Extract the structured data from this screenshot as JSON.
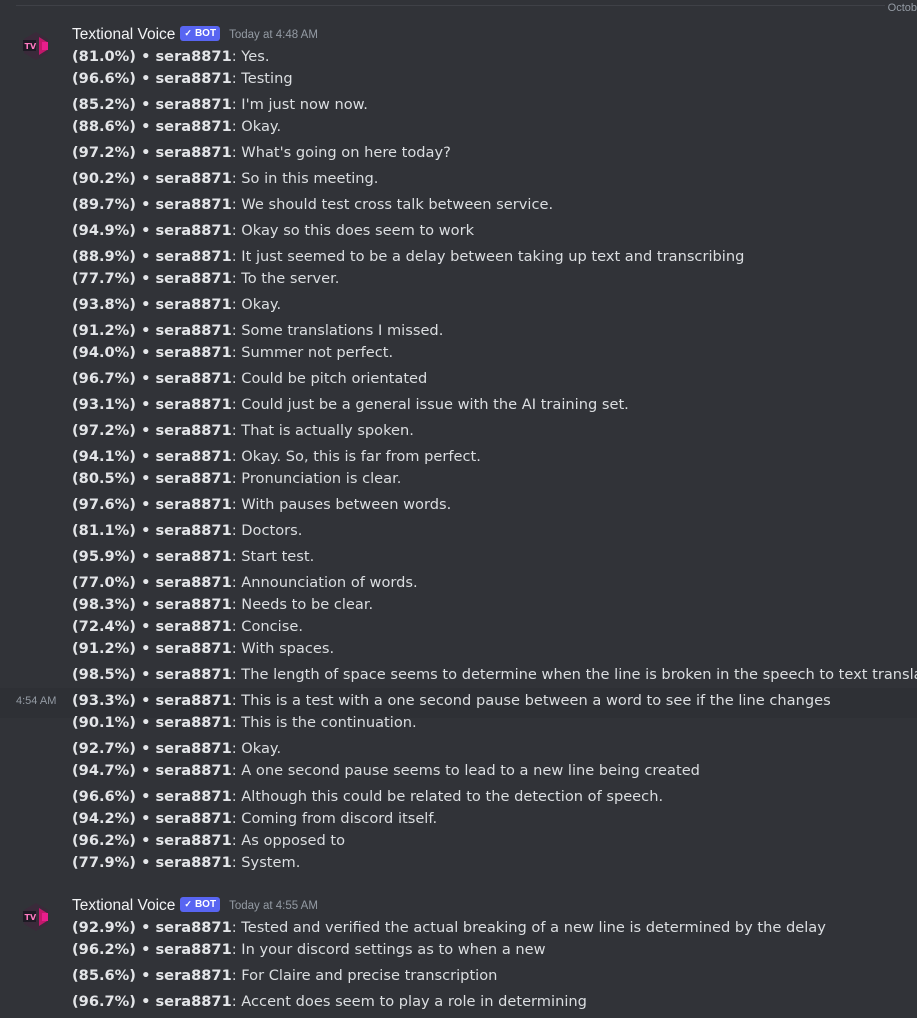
{
  "date_divider": "Octob",
  "groups": [
    {
      "author": "Textional Voice",
      "bot_label": "BOT",
      "timestamp": "Today at 4:48 AM",
      "avatar_text": "TV",
      "lines": [
        {
          "pct": "(81.0%)",
          "sep": " • ",
          "user": "sera8871",
          "text": ": Yes."
        },
        {
          "pct": "(96.6%)",
          "sep": " • ",
          "user": "sera8871",
          "text": ": Testing"
        },
        {
          "pct": "(85.2%)",
          "sep": " • ",
          "user": "sera8871",
          "text": ": I'm just now now."
        },
        {
          "pct": "(88.6%)",
          "sep": " • ",
          "user": "sera8871",
          "text": ": Okay."
        },
        {
          "pct": "(97.2%)",
          "sep": " • ",
          "user": "sera8871",
          "text": ": What's going on here today?"
        },
        {
          "pct": "(90.2%)",
          "sep": " • ",
          "user": "sera8871",
          "text": ": So in this meeting."
        },
        {
          "pct": "(89.7%)",
          "sep": " • ",
          "user": "sera8871",
          "text": ": We should test cross talk between service."
        },
        {
          "pct": "(94.9%)",
          "sep": " • ",
          "user": "sera8871",
          "text": ": Okay so this does seem to work"
        },
        {
          "pct": "(88.9%)",
          "sep": " • ",
          "user": "sera8871",
          "text": ": It just seemed to be a delay between taking up text and transcribing"
        },
        {
          "pct": "(77.7%)",
          "sep": " • ",
          "user": "sera8871",
          "text": ": To the server."
        },
        {
          "pct": "(93.8%)",
          "sep": " • ",
          "user": "sera8871",
          "text": ": Okay."
        },
        {
          "pct": "(91.2%)",
          "sep": " • ",
          "user": "sera8871",
          "text": ": Some translations I missed."
        },
        {
          "pct": "(94.0%)",
          "sep": " • ",
          "user": "sera8871",
          "text": ": Summer not perfect."
        },
        {
          "pct": "(96.7%)",
          "sep": " • ",
          "user": "sera8871",
          "text": ": Could be pitch orientated"
        },
        {
          "pct": "(93.1%)",
          "sep": " • ",
          "user": "sera8871",
          "text": ": Could just be a general issue with the AI training set."
        },
        {
          "pct": "(97.2%)",
          "sep": " • ",
          "user": "sera8871",
          "text": ": That is actually spoken."
        },
        {
          "pct": "(94.1%)",
          "sep": " • ",
          "user": "sera8871",
          "text": ": Okay. So, this is far from perfect."
        },
        {
          "pct": "(80.5%)",
          "sep": " • ",
          "user": "sera8871",
          "text": ": Pronunciation is clear."
        },
        {
          "pct": "(97.6%)",
          "sep": " • ",
          "user": "sera8871",
          "text": ": With pauses between words."
        },
        {
          "pct": "(81.1%)",
          "sep": " • ",
          "user": "sera8871",
          "text": ": Doctors."
        },
        {
          "pct": "(95.9%)",
          "sep": " • ",
          "user": "sera8871",
          "text": ": Start test."
        },
        {
          "pct": "(77.0%)",
          "sep": " • ",
          "user": "sera8871",
          "text": ": Announciation of words."
        },
        {
          "pct": "(98.3%)",
          "sep": " • ",
          "user": "sera8871",
          "text": ": Needs to be clear."
        },
        {
          "pct": "(72.4%)",
          "sep": " • ",
          "user": "sera8871",
          "text": ": Concise."
        },
        {
          "pct": "(91.2%)",
          "sep": " • ",
          "user": "sera8871",
          "text": ": With spaces."
        },
        {
          "pct": "(98.5%)",
          "sep": " • ",
          "user": "sera8871",
          "text": ": The length of space seems to determine when the line is broken in the speech to text translation"
        },
        {
          "pct": "(93.3%)",
          "sep": " • ",
          "user": "sera8871",
          "text": ": This is a test with a one second pause between a word to see if the line changes",
          "side_time": "4:54 AM"
        },
        {
          "pct": "(90.1%)",
          "sep": " • ",
          "user": "sera8871",
          "text": ": This is the continuation."
        },
        {
          "pct": "(92.7%)",
          "sep": " • ",
          "user": "sera8871",
          "text": ": Okay."
        },
        {
          "pct": "(94.7%)",
          "sep": " • ",
          "user": "sera8871",
          "text": ": A one second pause seems to lead to a new line being created"
        },
        {
          "pct": "(96.6%)",
          "sep": " • ",
          "user": "sera8871",
          "text": ": Although this could be related to the detection of speech."
        },
        {
          "pct": "(94.2%)",
          "sep": " • ",
          "user": "sera8871",
          "text": ": Coming from discord itself."
        },
        {
          "pct": "(96.2%)",
          "sep": " • ",
          "user": "sera8871",
          "text": ": As opposed to"
        },
        {
          "pct": "(77.9%)",
          "sep": " • ",
          "user": "sera8871",
          "text": ": System."
        }
      ]
    },
    {
      "author": "Textional Voice",
      "bot_label": "BOT",
      "timestamp": "Today at 4:55 AM",
      "avatar_text": "TV",
      "lines": [
        {
          "pct": "(92.9%)",
          "sep": " • ",
          "user": "sera8871",
          "text": ": Tested and verified the actual breaking of a new line is determined by the delay"
        },
        {
          "pct": "(96.2%)",
          "sep": " • ",
          "user": "sera8871",
          "text": ": In your discord settings as to when a new"
        },
        {
          "pct": "(85.6%)",
          "sep": " • ",
          "user": "sera8871",
          "text": ": For Claire and precise transcription"
        },
        {
          "pct": "(96.7%)",
          "sep": " • ",
          "user": "sera8871",
          "text": ": Accent does seem to play a role in determining"
        }
      ]
    }
  ]
}
